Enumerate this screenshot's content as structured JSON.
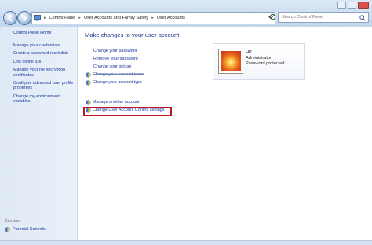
{
  "address_bar": {
    "breadcrumbs": [
      "Control Panel",
      "User Accounts and Family Safety",
      "User Accounts"
    ]
  },
  "search": {
    "placeholder": "Search Control Panel"
  },
  "left_pane": {
    "home": "Control Panel Home",
    "links": [
      "Manage your credentials",
      "Create a password reset disk",
      "Link online IDs",
      "Manage your file encryption certificates",
      "Configure advanced user profile properties",
      "Change my environment variables"
    ],
    "see_also_label": "See also",
    "see_also_links": [
      "Parental Controls"
    ]
  },
  "main": {
    "title": "Make changes to your user account",
    "tasks": [
      {
        "label": "Change your password",
        "icon": "none"
      },
      {
        "label": "Remove your password",
        "icon": "none"
      },
      {
        "label": "Change your picture",
        "icon": "none"
      },
      {
        "label": "Change your account name",
        "icon": "shield-icon"
      },
      {
        "label": "Change your account type",
        "icon": "shield-icon"
      }
    ],
    "tasks2": [
      {
        "label": "Manage another account",
        "icon": "shield-icon"
      },
      {
        "label": "Change User Account Control settings",
        "icon": "shield-icon"
      }
    ]
  },
  "account": {
    "name": "HP",
    "type": "Administrator",
    "status": "Password protected"
  },
  "colors": {
    "link": "#17379f",
    "title": "#1e3287",
    "highlight_border": "#c1151d",
    "left_pane_bg": "#dfe9f5"
  }
}
